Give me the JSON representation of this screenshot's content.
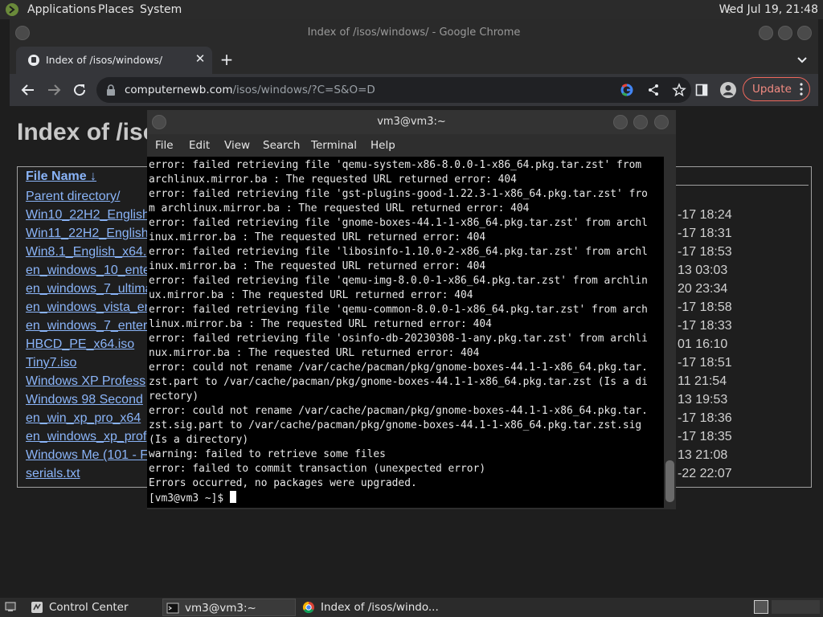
{
  "top_panel": {
    "menus": [
      "Applications",
      "Places",
      "System"
    ],
    "clock": "Wed Jul 19, 21:48"
  },
  "chrome": {
    "window_title": "Index of /isos/windows/ - Google Chrome",
    "tab_title": "Index of /isos/windows/",
    "url_domain": "computernewb.com",
    "url_path": "/isos/windows/?C=S&O=D",
    "update_label": "Update",
    "page": {
      "title": "Index of /iso",
      "column_header": "File Name  ↓",
      "files": [
        {
          "name": "Parent directory/",
          "date": ""
        },
        {
          "name": "Win10_22H2_English",
          "date": "-17 18:24"
        },
        {
          "name": "Win11_22H2_English",
          "date": "-17 18:31"
        },
        {
          "name": "Win8.1_English_x64.",
          "date": "-17 18:53"
        },
        {
          "name": "en_windows_10_ente",
          "date": "13 03:03"
        },
        {
          "name": "en_windows_7_ultima",
          "date": "20 23:34"
        },
        {
          "name": "en_windows_vista_en",
          "date": "-17 18:58"
        },
        {
          "name": "en_windows_7_enter",
          "date": "-17 18:33"
        },
        {
          "name": "HBCD_PE_x64.iso",
          "date": "01 16:10"
        },
        {
          "name": "Tiny7.iso",
          "date": "-17 18:51"
        },
        {
          "name": "Windows XP Profess",
          "date": "11 21:54"
        },
        {
          "name": "Windows 98 Second",
          "date": "13 19:53"
        },
        {
          "name": "en_win_xp_pro_x64",
          "date": "-17 18:36"
        },
        {
          "name": "en_windows_xp_prof",
          "date": "-17 18:35"
        },
        {
          "name": "Windows Me (101 - F",
          "date": "13 21:08"
        },
        {
          "name": "serials.txt",
          "date": "-22 22:07"
        }
      ]
    }
  },
  "terminal": {
    "window_title": "vm3@vm3:~",
    "menus": [
      "File",
      "Edit",
      "View",
      "Search",
      "Terminal",
      "Help"
    ],
    "lines": [
      "error: failed retrieving file 'qemu-system-x86-8.0.0-1-x86_64.pkg.tar.zst' from",
      "archlinux.mirror.ba : The requested URL returned error: 404",
      "error: failed retrieving file 'gst-plugins-good-1.22.3-1-x86_64.pkg.tar.zst' fro",
      "m archlinux.mirror.ba : The requested URL returned error: 404",
      "error: failed retrieving file 'gnome-boxes-44.1-1-x86_64.pkg.tar.zst' from archl",
      "inux.mirror.ba : The requested URL returned error: 404",
      "error: failed retrieving file 'libosinfo-1.10.0-2-x86_64.pkg.tar.zst' from archl",
      "inux.mirror.ba : The requested URL returned error: 404",
      "error: failed retrieving file 'qemu-img-8.0.0-1-x86_64.pkg.tar.zst' from archlin",
      "ux.mirror.ba : The requested URL returned error: 404",
      "error: failed retrieving file 'qemu-common-8.0.0-1-x86_64.pkg.tar.zst' from arch",
      "linux.mirror.ba : The requested URL returned error: 404",
      "error: failed retrieving file 'osinfo-db-20230308-1-any.pkg.tar.zst' from archli",
      "nux.mirror.ba : The requested URL returned error: 404",
      "error: could not rename /var/cache/pacman/pkg/gnome-boxes-44.1-1-x86_64.pkg.tar.",
      "zst.part to /var/cache/pacman/pkg/gnome-boxes-44.1-1-x86_64.pkg.tar.zst (Is a di",
      "rectory)",
      "error: could not rename /var/cache/pacman/pkg/gnome-boxes-44.1-1-x86_64.pkg.tar.",
      "zst.sig.part to /var/cache/pacman/pkg/gnome-boxes-44.1-1-x86_64.pkg.tar.zst.sig",
      "(Is a directory)",
      "warning: failed to retrieve some files",
      "error: failed to commit transaction (unexpected error)",
      "Errors occurred, no packages were upgraded."
    ],
    "prompt": "[vm3@vm3 ~]$ "
  },
  "taskbar": {
    "items": [
      "Control Center",
      "vm3@vm3:~",
      "Index of /isos/windo..."
    ]
  }
}
